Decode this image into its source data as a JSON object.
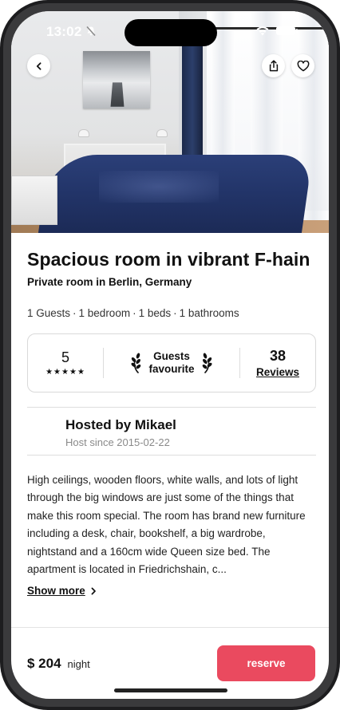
{
  "status_bar": {
    "time": "13:02"
  },
  "hero": {
    "back_icon": "chevron-left-icon",
    "share_icon": "share-icon",
    "favorite_icon": "heart-icon"
  },
  "listing": {
    "title": "Spacious room in vibrant F-hain",
    "subtitle": "Private room in Berlin, Germany",
    "specs": [
      "1 Guests",
      "1 bedroom",
      "1 beds",
      "1 bathrooms"
    ]
  },
  "stats": {
    "rating_value": "5",
    "rating_stars": "★★★★★",
    "badge_line1": "Guests",
    "badge_line2": "favourite",
    "reviews_count": "38",
    "reviews_label": "Reviews"
  },
  "host": {
    "name": "Hosted by Mikael",
    "since": "Host since 2015-02-22"
  },
  "description": {
    "text": "High ceilings, wooden floors, white walls, and lots of light through the big windows are just some of the things that make this room special. The room has brand new furniture including a desk, chair, bookshelf, a big wardrobe, nightstand and a 160cm wide Queen size bed.  The apartment is located in Friedrichshain, c...",
    "show_more": "Show more"
  },
  "footer": {
    "price": "$ 204",
    "price_unit": "night",
    "reserve_label": "reserve"
  },
  "colors": {
    "accent": "#ea4a5f"
  }
}
